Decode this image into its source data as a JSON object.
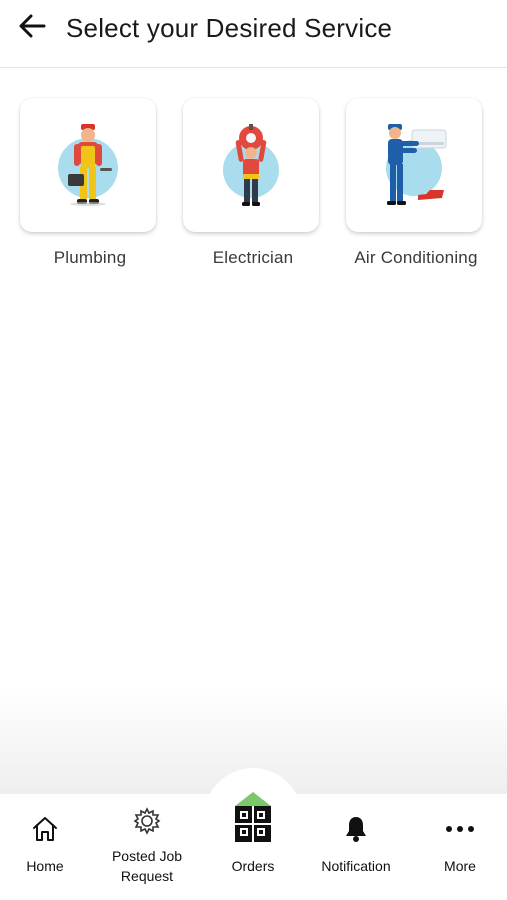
{
  "header": {
    "back_icon": "arrow-left-icon",
    "title": "Select your Desired Service"
  },
  "services": [
    {
      "label": "Plumbing",
      "icon": "plumber-illustration"
    },
    {
      "label": "Electrician",
      "icon": "electrician-illustration"
    },
    {
      "label": "Air Conditioning",
      "icon": "ac-technician-illustration"
    }
  ],
  "bottom_nav": {
    "items": [
      {
        "label": "Home",
        "icon": "home-icon"
      },
      {
        "label": "Posted Job Request",
        "icon": "gear-icon"
      },
      {
        "label": "Orders",
        "icon": "house-orders-icon"
      },
      {
        "label": "Notification",
        "icon": "bell-icon"
      },
      {
        "label": "More",
        "icon": "more-dots-icon"
      }
    ]
  },
  "colors": {
    "illustration_circle": "#a9dcec",
    "plumber_outfit": "#f0c419",
    "shirt_red": "#e0493b",
    "ac_outfit": "#1f5ea8",
    "orders_roof": "#7cc76b",
    "text_primary": "#1a1a1a"
  }
}
